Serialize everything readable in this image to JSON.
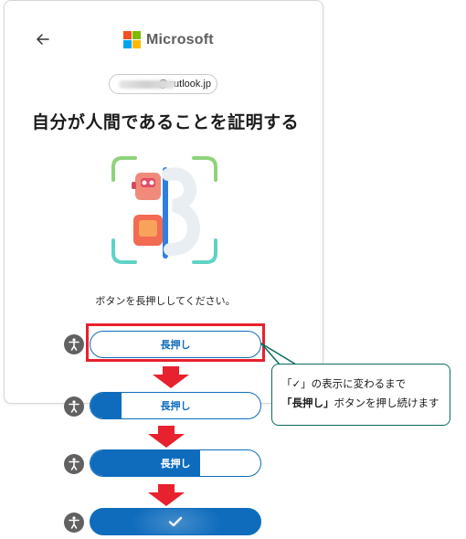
{
  "header": {
    "brand": "Microsoft",
    "brand_colors": [
      "#f25022",
      "#7fba00",
      "#00a4ef",
      "#ffb900"
    ]
  },
  "account": {
    "email_visible_suffix": "@outlook.jp"
  },
  "main": {
    "title": "自分が人間であることを証明する",
    "instruction": "ボタンを長押ししてください。"
  },
  "press_buttons": [
    {
      "label": "長押し",
      "progress": 0
    },
    {
      "label": "長押し",
      "progress": 0.2
    },
    {
      "label": "長押し",
      "progress": 0.65
    },
    {
      "label": "",
      "progress": 1,
      "state_icon": "check-icon"
    }
  ],
  "callout": {
    "line1": "「✓」の表示に変わるまで",
    "line2_bold": "「長押し」",
    "line2_rest": "ボタンを押し続けます"
  },
  "colors": {
    "accent": "#0f6cbd",
    "highlight_red": "#e8212e",
    "callout_border": "#0a6b5e"
  }
}
